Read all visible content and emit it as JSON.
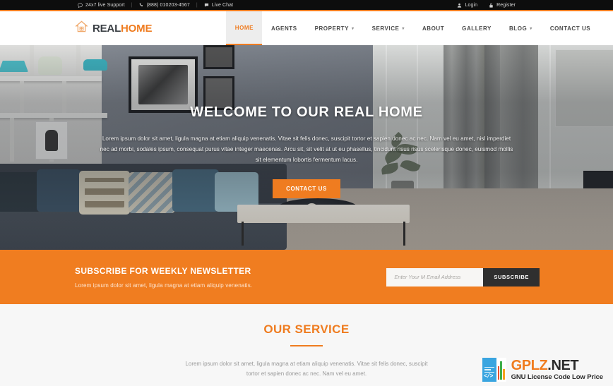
{
  "topbar": {
    "support": "24x7 live Support",
    "phone": "(888) 010203-4567",
    "chat": "Live Chat",
    "login": "Login",
    "register": "Register",
    "separator": "|",
    "icons": {
      "support": "chat-bubble-icon",
      "phone": "phone-icon",
      "chat": "message-icon",
      "login": "user-icon",
      "register": "lock-icon"
    }
  },
  "header": {
    "logo_icon": "house-icon",
    "logo_part1": "REAL",
    "logo_part2": "HOME",
    "nav": [
      {
        "label": "HOME",
        "active": true,
        "caret": ""
      },
      {
        "label": "AGENTS",
        "active": false,
        "caret": ""
      },
      {
        "label": "PROPERTY",
        "active": false,
        "caret": "▾"
      },
      {
        "label": "SERVICE",
        "active": false,
        "caret": "▾"
      },
      {
        "label": "ABOUT",
        "active": false,
        "caret": ""
      },
      {
        "label": "GALLERY",
        "active": false,
        "caret": ""
      },
      {
        "label": "BLOG",
        "active": false,
        "caret": "▾"
      },
      {
        "label": "CONTACT US",
        "active": false,
        "caret": ""
      }
    ]
  },
  "hero": {
    "title": "WELCOME TO OUR REAL HOME",
    "description": "Lorem ipsum dolor sit amet, ligula magna at etiam aliquip venenatis. Vitae sit felis donec, suscipit tortor et sapien donec ac nec. Nam vel eu amet, nisl imperdiet nec ad morbi, sodales ipsum, consequat purus vitae integer maecenas. Arcu sit, sit velit at ut eu phasellus, tincidunt risus risus scelerisque donec, euismod mollis sit elementum lobortis fermentum lacus.",
    "cta_label": "CONTACT US"
  },
  "newsletter": {
    "title": "SUBSCRIBE FOR WEEKLY NEWSLETTER",
    "subtitle": "Lorem ipsum dolor sit amet, ligula magna at etiam aliquip venenatis.",
    "input_placeholder": "Enter Your M Email Address",
    "input_value": "",
    "button_label": "SUBSCRIBE"
  },
  "service": {
    "title": "OUR SERVICE",
    "description": "Lorem ipsum dolor sit amet, ligula magna at etiam aliquip venenatis. Vitae sit felis donec, suscipit tortor et sapien donec ac nec. Nam vel eu amet."
  },
  "watermark": {
    "brand_name": "GPLZ",
    "brand_tld": ".NET",
    "tagline": "GNU License Code Low Price",
    "code_glyph": "</>"
  },
  "colors": {
    "accent_orange": "#ef7c20",
    "newsletter_orange": "#f07d20",
    "topbar_black": "#0d0d0d",
    "dark_button": "#2f2f2f",
    "service_bg": "#f7f7f7",
    "nav_active_bg": "#ededed"
  }
}
